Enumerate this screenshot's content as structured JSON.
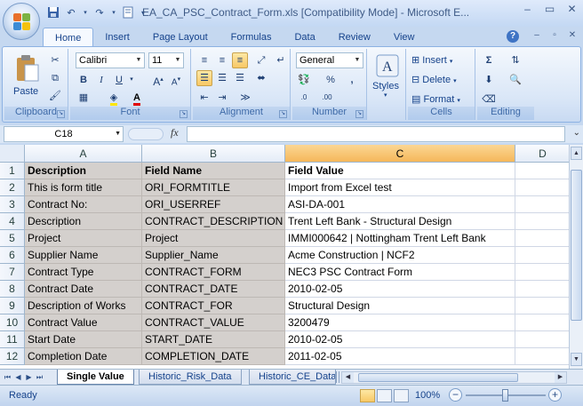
{
  "window": {
    "title": "EA_CA_PSC_Contract_Form.xls  [Compatibility Mode]  -  Microsoft E...",
    "controls": [
      "–",
      "▭",
      "✕"
    ]
  },
  "tabs": [
    "Home",
    "Insert",
    "Page Layout",
    "Formulas",
    "Data",
    "Review",
    "View"
  ],
  "active_tab": "Home",
  "ribbon": {
    "clipboard": {
      "label": "Clipboard",
      "paste": "Paste"
    },
    "font": {
      "label": "Font",
      "name": "Calibri",
      "size": "11"
    },
    "alignment": {
      "label": "Alignment"
    },
    "number": {
      "label": "Number",
      "format": "General"
    },
    "styles": {
      "label": "Styles"
    },
    "cells": {
      "label": "Cells",
      "insert": "Insert",
      "delete": "Delete",
      "format": "Format"
    },
    "editing": {
      "label": "Editing"
    }
  },
  "formula_bar": {
    "name_box": "C18",
    "fx": "fx",
    "formula": ""
  },
  "grid": {
    "columns": [
      "A",
      "B",
      "C",
      "D"
    ],
    "selected_column": "C",
    "rows": [
      {
        "num": "1",
        "a": "Description",
        "b": "Field Name",
        "c": "Field Value"
      },
      {
        "num": "2",
        "a": "This is form title",
        "b": "ORI_FORMTITLE",
        "c": "Import from Excel test"
      },
      {
        "num": "3",
        "a": "Contract No:",
        "b": "ORI_USERREF",
        "c": "ASI-DA-001"
      },
      {
        "num": "4",
        "a": "Description",
        "b": "CONTRACT_DESCRIPTION",
        "c": "Trent Left Bank - Structural Design"
      },
      {
        "num": "5",
        "a": "Project",
        "b": "Project",
        "c": "IMMI000642 | Nottingham Trent Left Bank"
      },
      {
        "num": "6",
        "a": "Supplier Name",
        "b": "Supplier_Name",
        "c": " Acme Construction | NCF2"
      },
      {
        "num": "7",
        "a": "Contract Type",
        "b": "CONTRACT_FORM",
        "c": "NEC3 PSC Contract Form"
      },
      {
        "num": "8",
        "a": "Contract Date",
        "b": "CONTRACT_DATE",
        "c": "2010-02-05"
      },
      {
        "num": "9",
        "a": "Description of Works",
        "b": "CONTRACT_FOR",
        "c": "Structural Design"
      },
      {
        "num": "10",
        "a": "Contract Value",
        "b": "CONTRACT_VALUE",
        "c": "3200479"
      },
      {
        "num": "11",
        "a": "Start Date",
        "b": "START_DATE",
        "c": "2010-02-05"
      },
      {
        "num": "12",
        "a": "Completion Date",
        "b": "COMPLETION_DATE",
        "c": "2011-02-05"
      }
    ]
  },
  "sheet_tabs": [
    "Single Value",
    "Historic_Risk_Data",
    "Historic_CE_Data"
  ],
  "active_sheet": "Single Value",
  "status": {
    "text": "Ready",
    "zoom": "100%"
  }
}
